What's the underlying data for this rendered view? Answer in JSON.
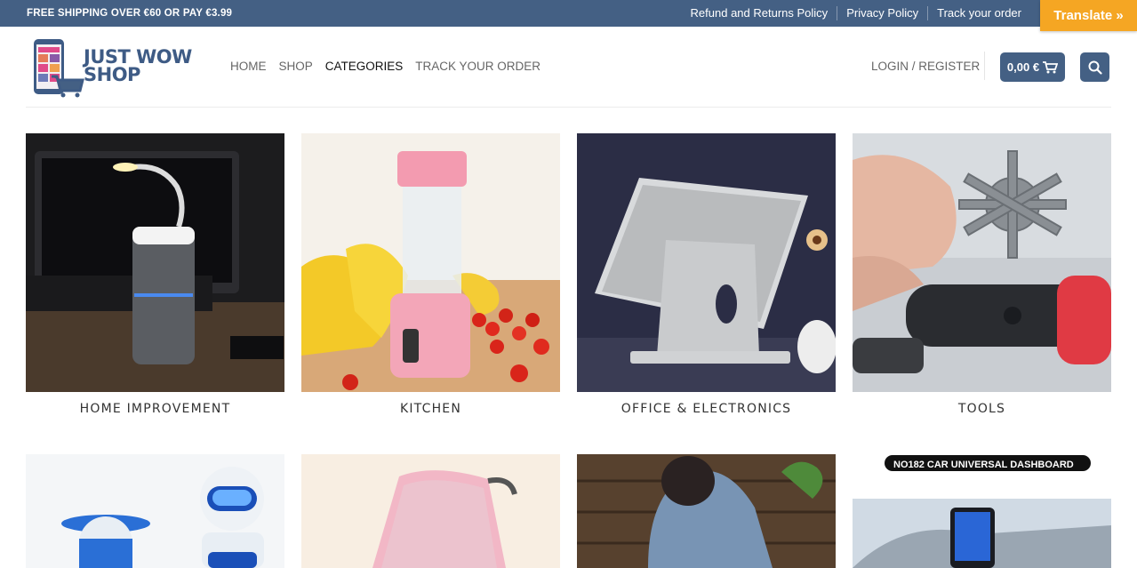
{
  "topbar": {
    "shipping_text": "FREE SHIPPING OVER €60 OR PAY €3.99",
    "links": [
      "Refund and Returns Policy",
      "Privacy Policy",
      "Track your order"
    ],
    "translate_label": "Translate »"
  },
  "header": {
    "logo_line1": "JUST WOW",
    "logo_line2": "SHOP",
    "nav": [
      "HOME",
      "SHOP",
      "CATEGORIES",
      "TRACK YOUR ORDER"
    ],
    "active_nav": "CATEGORIES",
    "login_label": "LOGIN / REGISTER",
    "cart_total": "0,00 €"
  },
  "categories": [
    {
      "label": "HOME IMPROVEMENT",
      "image": "usb-lamp-humidifier"
    },
    {
      "label": "KITCHEN",
      "image": "pink-portable-blender"
    },
    {
      "label": "OFFICE & ELECTRONICS",
      "image": "tablet-stand"
    },
    {
      "label": "TOOLS",
      "image": "snowflake-multitool"
    },
    {
      "label": "",
      "image": "toy-robots"
    },
    {
      "label": "",
      "image": "pink-stroller-cover"
    },
    {
      "label": "",
      "image": "denim-jacket-woman"
    },
    {
      "label": "",
      "image": "car-dashboard-phone-holder"
    }
  ],
  "colors": {
    "brand": "#446084",
    "translate": "#f5a623"
  }
}
